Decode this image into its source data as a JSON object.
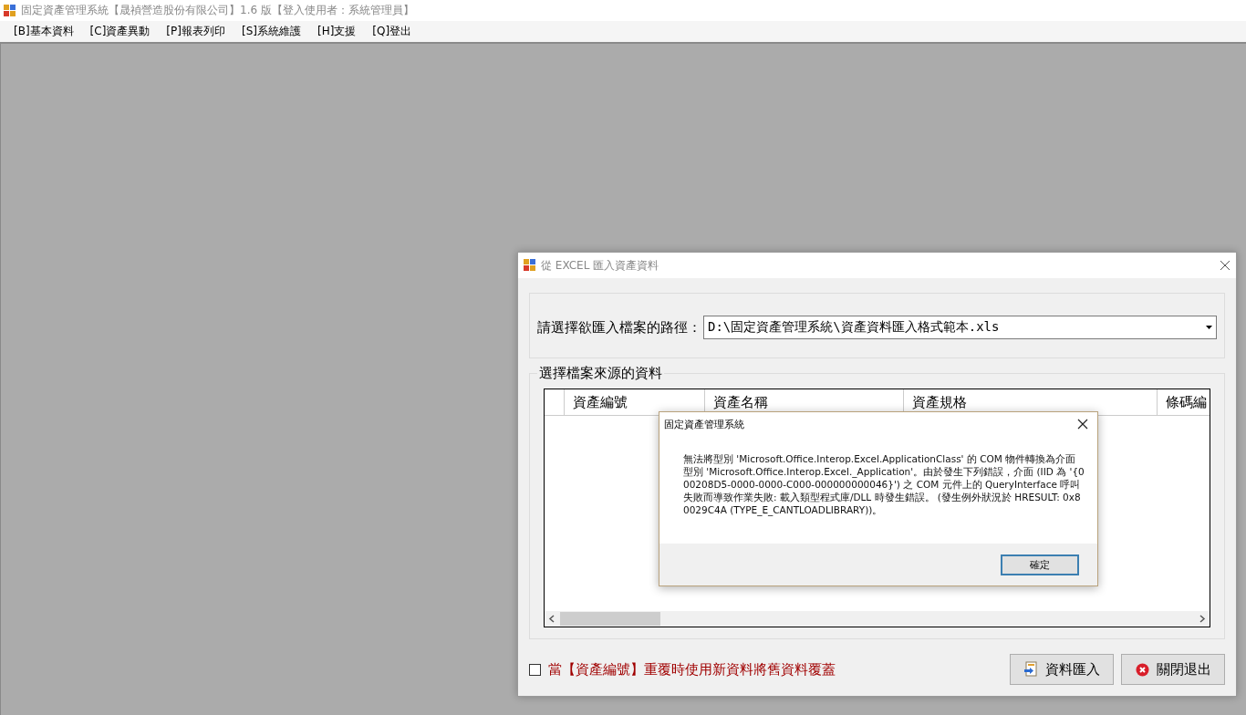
{
  "window": {
    "title": "固定資產管理系統【晟禎營造股份有限公司】1.6 版【登入使用者：系統管理員】"
  },
  "menu": [
    "[B]基本資料",
    "[C]資產異動",
    "[P]報表列印",
    "[S]系統維護",
    "[H]支援",
    "[Q]登出"
  ],
  "import_dialog": {
    "title": "從 EXCEL 匯入資產資料",
    "path_label": "請選擇欲匯入檔案的路徑：",
    "path_value": "D:\\固定資產管理系統\\資產資料匯入格式範本.xls",
    "group_title": "選擇檔案來源的資料",
    "table": {
      "columns": [
        "資產編號",
        "資產名稱",
        "資產規格",
        "條碼編"
      ]
    },
    "overwrite": {
      "label": "當【資產編號】重覆時使用新資料將舊資料覆蓋",
      "checked": false
    },
    "buttons": [
      {
        "kind": "import",
        "label": "資料匯入"
      },
      {
        "kind": "close",
        "label": "關閉退出"
      }
    ]
  },
  "message_box": {
    "title": "固定資產管理系統",
    "message": "無法將型別 'Microsoft.Office.Interop.Excel.ApplicationClass' 的 COM 物件轉換為介面型別 'Microsoft.Office.Interop.Excel._Application'。由於發生下列錯誤，介面 (IID 為 '{000208D5-0000-0000-C000-000000000046}') 之 COM 元件上的 QueryInterface 呼叫失敗而導致作業失敗: 載入類型程式庫/DLL 時發生錯誤。 (發生例外狀況於 HRESULT: 0x80029C4A (TYPE_E_CANTLOADLIBRARY))。",
    "button": "確定"
  }
}
